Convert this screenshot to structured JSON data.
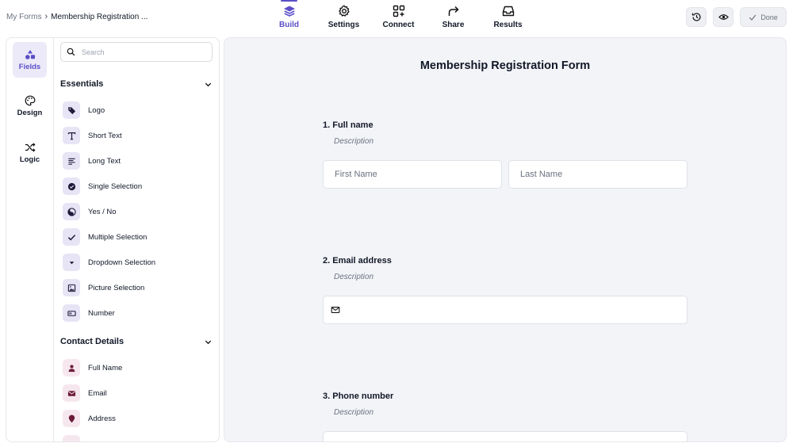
{
  "breadcrumb": {
    "root": "My Forms",
    "separator": "›",
    "current": "Membership Registration ..."
  },
  "nav": [
    {
      "label": "Build",
      "icon": "layers-icon",
      "active": true
    },
    {
      "label": "Settings",
      "icon": "gear-icon",
      "active": false
    },
    {
      "label": "Connect",
      "icon": "connect-icon",
      "active": false
    },
    {
      "label": "Share",
      "icon": "share-arrow-icon",
      "active": false
    },
    {
      "label": "Results",
      "icon": "inbox-icon",
      "active": false
    }
  ],
  "toolbar": {
    "done_label": "Done",
    "history_icon": "history-icon",
    "preview_icon": "eye-icon"
  },
  "rail": [
    {
      "label": "Fields",
      "icon": "shapes-icon",
      "active": true
    },
    {
      "label": "Design",
      "icon": "palette-icon",
      "active": false
    },
    {
      "label": "Logic",
      "icon": "shuffle-icon",
      "active": false
    }
  ],
  "search": {
    "placeholder": "Search",
    "value": ""
  },
  "sections": {
    "essentials": {
      "title": "Essentials",
      "items": [
        "Logo",
        "Short Text",
        "Long Text",
        "Single Selection",
        "Yes / No",
        "Multiple Selection",
        "Dropdown Selection",
        "Picture Selection",
        "Number"
      ]
    },
    "contact": {
      "title": "Contact Details",
      "items": [
        "Full Name",
        "Email",
        "Address"
      ]
    }
  },
  "form": {
    "title": "Membership Registration Form",
    "questions": [
      {
        "label": "1.  Full name",
        "description": "Description",
        "placeholders": [
          "First Name",
          "Last Name"
        ]
      },
      {
        "label": "2. Email address",
        "description": "Description"
      },
      {
        "label": "3. Phone number",
        "description": "Description"
      }
    ]
  },
  "colors": {
    "accent": "#5b4ec7",
    "contact_accent": "#6b1a3a",
    "canvas_bg": "#f3f4f8"
  }
}
